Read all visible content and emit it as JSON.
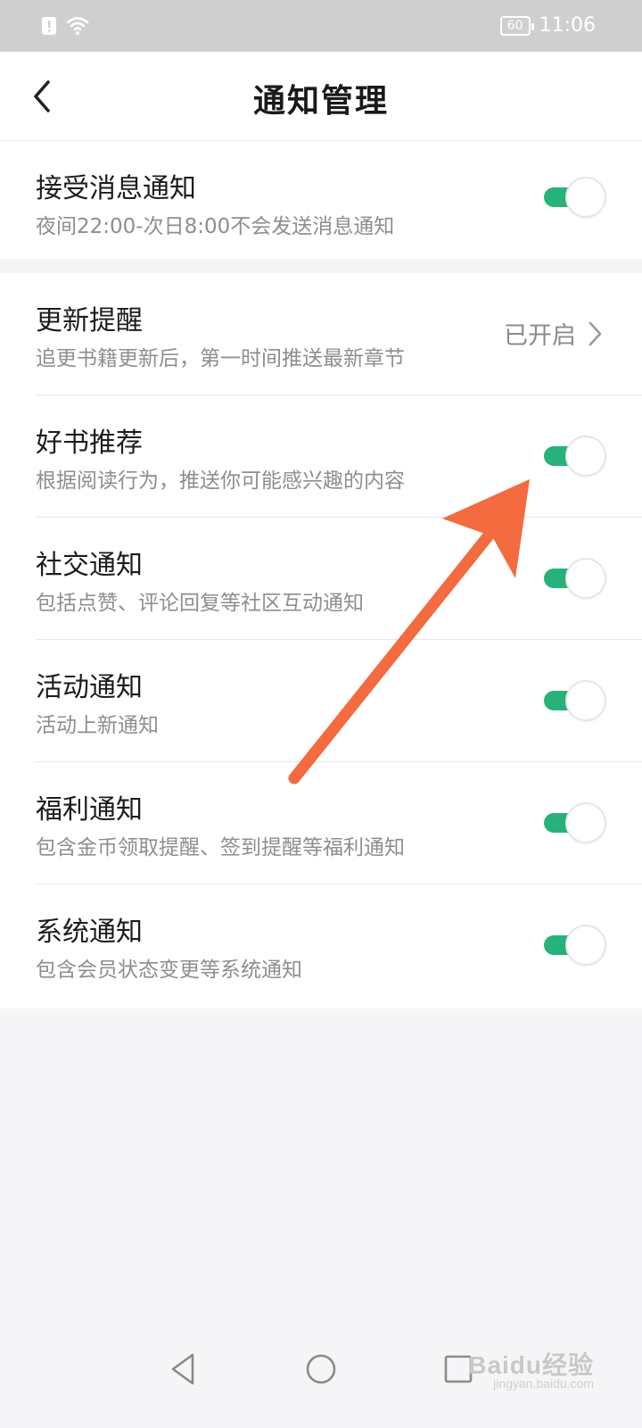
{
  "status_bar": {
    "battery": "60",
    "time": "11:06",
    "icons": [
      "alert-icon",
      "wifi-icon"
    ]
  },
  "header": {
    "title": "通知管理",
    "back_icon": "chevron-left-icon"
  },
  "section1": {
    "title": "接受消息通知",
    "subtitle": "夜间22:00-次日8:00不会发送消息通知",
    "toggle_on": true
  },
  "settings": [
    {
      "title": "更新提醒",
      "subtitle": "追更书籍更新后，第一时间推送最新章节",
      "status": "已开启"
    },
    {
      "title": "好书推荐",
      "subtitle": "根据阅读行为，推送你可能感兴趣的内容",
      "toggle_on": true
    },
    {
      "title": "社交通知",
      "subtitle": "包括点赞、评论回复等社区互动通知",
      "toggle_on": true
    },
    {
      "title": "活动通知",
      "subtitle": "活动上新通知",
      "toggle_on": true
    },
    {
      "title": "福利通知",
      "subtitle": "包含金币领取提醒、签到提醒等福利通知",
      "toggle_on": true
    },
    {
      "title": "系统通知",
      "subtitle": "包含会员状态变更等系统通知",
      "toggle_on": true
    }
  ],
  "colors": {
    "toggle_on": "#26b27a",
    "arrow": "#f36b3f",
    "background": "#f5f5f7"
  },
  "nav": {
    "icons": [
      "back-triangle-icon",
      "home-circle-icon",
      "recents-square-icon"
    ]
  },
  "watermark": {
    "brand": "Baidu经验",
    "url": "jingyan.baidu.com"
  }
}
